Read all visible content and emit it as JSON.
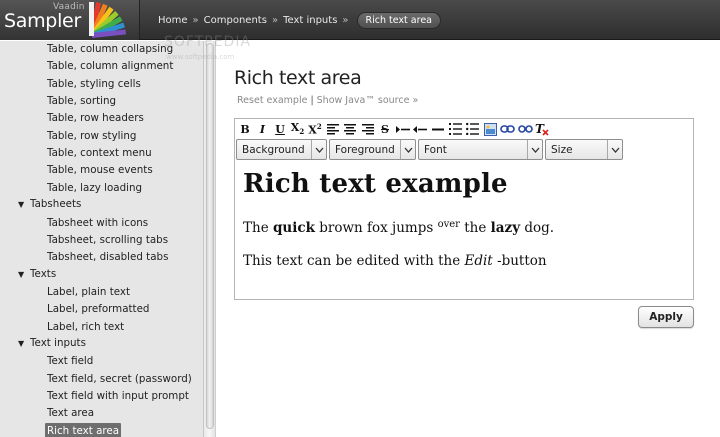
{
  "header": {
    "logo_small": "Vaadin",
    "logo_large": "Sampler",
    "breadcrumbs": [
      "Home",
      "Components",
      "Text inputs"
    ],
    "separator": "»",
    "current": "Rich text area"
  },
  "watermark": {
    "text": "SOFTPEDIA",
    "sub": "www.softpedia.com"
  },
  "sidebar": {
    "items": [
      {
        "type": "leaf",
        "label": "Table, column collapsing"
      },
      {
        "type": "leaf",
        "label": "Table, column alignment"
      },
      {
        "type": "leaf",
        "label": "Table, styling cells"
      },
      {
        "type": "leaf",
        "label": "Table, sorting"
      },
      {
        "type": "leaf",
        "label": "Table, row headers"
      },
      {
        "type": "leaf",
        "label": "Table, row styling"
      },
      {
        "type": "leaf",
        "label": "Table, context menu"
      },
      {
        "type": "leaf",
        "label": "Table, mouse events"
      },
      {
        "type": "leaf",
        "label": "Table, lazy loading"
      },
      {
        "type": "category",
        "label": "Tabsheets"
      },
      {
        "type": "leaf",
        "label": "Tabsheet with icons"
      },
      {
        "type": "leaf",
        "label": "Tabsheet, scrolling tabs"
      },
      {
        "type": "leaf",
        "label": "Tabsheet, disabled tabs"
      },
      {
        "type": "category",
        "label": "Texts"
      },
      {
        "type": "leaf",
        "label": "Label, plain text"
      },
      {
        "type": "leaf",
        "label": "Label, preformatted"
      },
      {
        "type": "leaf",
        "label": "Label, rich text"
      },
      {
        "type": "category",
        "label": "Text inputs"
      },
      {
        "type": "leaf",
        "label": "Text field"
      },
      {
        "type": "leaf",
        "label": "Text field, secret (password)"
      },
      {
        "type": "leaf",
        "label": "Text field with input prompt"
      },
      {
        "type": "leaf",
        "label": "Text area"
      },
      {
        "type": "leaf",
        "label": "Rich text area",
        "selected": true
      }
    ]
  },
  "main": {
    "title": "Rich text area",
    "reset_link": "Reset example",
    "java_link": "Show Java™ source »"
  },
  "editor": {
    "toolbar_icons": [
      "bold-icon",
      "italic-icon",
      "underline-icon",
      "subscript-icon",
      "superscript-icon",
      "align-left-icon",
      "align-center-icon",
      "align-right-icon",
      "strikethrough-icon",
      "indent-icon",
      "outdent-icon",
      "horizontal-rule-icon",
      "ordered-list-icon",
      "unordered-list-icon",
      "image-icon",
      "link-icon",
      "unlink-icon",
      "remove-format-icon"
    ],
    "selects": {
      "background": "Background",
      "foreground": "Foreground",
      "font": "Font",
      "size": "Size"
    },
    "heading": "Rich text example",
    "p1": {
      "w1": "The ",
      "w2": "quick",
      "w3": " brown fox jumps ",
      "w4": "over",
      "w5": " the ",
      "w6": "lazy",
      "w7": " dog."
    },
    "p2": {
      "w1": "This text can be edited with the ",
      "w2": "Edit",
      "w3": " -button"
    }
  },
  "apply_label": "Apply",
  "colors": {
    "topbar": "#3a3a3a",
    "sidebar": "#e6e6e6",
    "selected": "#6e6e6e"
  }
}
